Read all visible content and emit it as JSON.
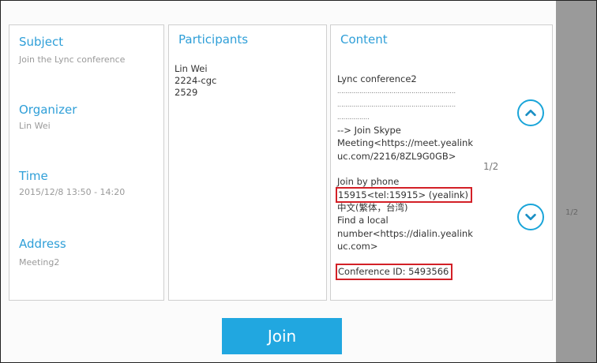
{
  "details": {
    "subject_label": "Subject",
    "subject_value": "Join the Lync conference",
    "organizer_label": "Organizer",
    "organizer_value": "Lin Wei",
    "time_label": "Time",
    "time_value": "2015/12/8 13:50 - 14:20",
    "address_label": "Address",
    "address_value": "Meeting2"
  },
  "participants": {
    "label": "Participants",
    "items": [
      "Lin Wei",
      "2224-cgc",
      "2529"
    ]
  },
  "content": {
    "label": "Content",
    "lines": [
      "Lync conference2",
      "...........................................................",
      "...........................................................",
      "................",
      "--> Join Skype",
      "Meeting<https://meet.yealink",
      "uc.com/2216/8ZL9G0GB>",
      "",
      "Join by phone",
      "15915<tel:15915> (yealink)",
      "中文(繁体，台湾)",
      "Find a local",
      "number<https://dialin.yealink",
      "uc.com>",
      "",
      "Conference ID: 5493566"
    ],
    "page_indicator": "1/2"
  },
  "background_page_indicator": "1/2",
  "join_label": "Join",
  "colors": {
    "accent": "#21a7e0",
    "label_blue": "#2f9fd8",
    "highlight_red": "#d32027"
  },
  "icons": {
    "scroll_up": "chevron-up-icon",
    "scroll_down": "chevron-down-icon"
  }
}
